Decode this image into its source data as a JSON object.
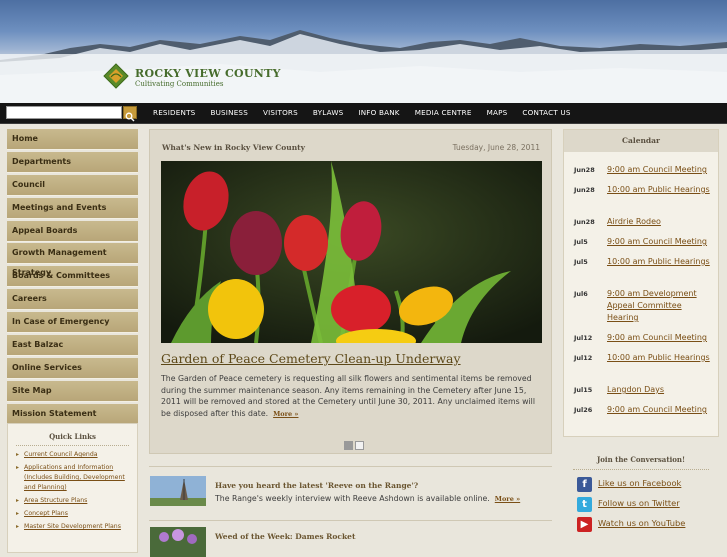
{
  "header": {
    "org_name": "ROCKY VIEW COUNTY",
    "tagline": "Cultivating Communities"
  },
  "search": {
    "value": "",
    "button_icon": "search-icon"
  },
  "nav": {
    "items": [
      "RESIDENTS",
      "BUSINESS",
      "VISITORS",
      "BYLAWS",
      "INFO BANK",
      "MEDIA CENTRE",
      "MAPS",
      "CONTACT US"
    ]
  },
  "left_nav": {
    "items": [
      "Home",
      "Departments",
      "Council",
      "Meetings and Events",
      "Appeal Boards",
      "Growth Management Strategy",
      "Boards & Committees",
      "Careers",
      "In Case of Emergency",
      "East Balzac",
      "Online Services",
      "Site Map",
      "Mission Statement"
    ]
  },
  "quick_links": {
    "title": "Quick Links",
    "items": [
      "Current Council Agenda",
      "Applications and Information (Includes Building, Development and Planning)",
      "Area Structure Plans",
      "Concept Plans",
      "Master Site Development Plans"
    ]
  },
  "main": {
    "heading": "What's New in Rocky View County",
    "date": "Tuesday, June 28, 2011",
    "feature": {
      "title": "Garden of Peace Cemetery Clean-up Underway",
      "text": "The Garden of Peace cemetery is requesting all silk flowers and sentimental items be removed during the summer maintenance season. Any items remaining in the Cemetery after June 15, 2011 will be removed and stored at the Cemetery until June 30, 2011. Any unclaimed items will be disposed after this date.",
      "more": "More »"
    },
    "slides": {
      "count": 2,
      "active": 1
    }
  },
  "news": [
    {
      "title": "Have you heard the latest 'Reeve on the Range'?",
      "text": "The Range's weekly interview with Reeve Ashdown is available online.",
      "more": "More »"
    },
    {
      "title": "Weed of the Week: Dames Rocket",
      "text": "",
      "more": ""
    }
  ],
  "calendar": {
    "title": "Calendar",
    "events": [
      {
        "date": "Jun28",
        "text": "9:00 am Council Meeting"
      },
      {
        "date": "Jun28",
        "text": "10:00 am Public Hearings"
      },
      {
        "date": "Jun28",
        "text": "Airdrie Rodeo"
      },
      {
        "date": "Jul5",
        "text": "9:00 am Council Meeting"
      },
      {
        "date": "Jul5",
        "text": "10:00 am Public Hearings"
      },
      {
        "date": "Jul6",
        "text": "9:00 am Development Appeal Committee Hearing"
      },
      {
        "date": "Jul12",
        "text": "9:00 am Council Meeting"
      },
      {
        "date": "Jul12",
        "text": "10:00 am Public Hearings"
      },
      {
        "date": "Jul15",
        "text": "Langdon Days"
      },
      {
        "date": "Jul26",
        "text": "9:00 am Council Meeting"
      }
    ]
  },
  "social": {
    "title": "Join the Conversation!",
    "items": [
      {
        "label": "Like us on Facebook",
        "icon": "facebook-icon",
        "glyph": "f",
        "color": "#3b5998"
      },
      {
        "label": "Follow us on Twitter",
        "icon": "twitter-icon",
        "glyph": "t",
        "color": "#33aadd"
      },
      {
        "label": "Watch us on YouTube",
        "icon": "youtube-icon",
        "glyph": "▶",
        "color": "#cc2222"
      }
    ]
  }
}
